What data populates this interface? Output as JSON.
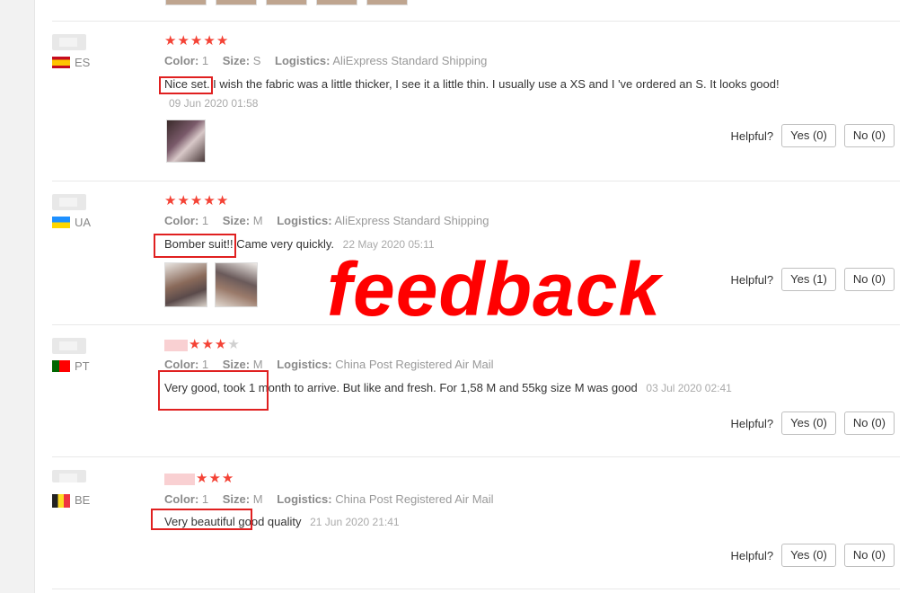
{
  "reviews": [
    {
      "country": "ES",
      "color_label": "Color:",
      "color_value": "1",
      "size_label": "Size:",
      "size_value": "S",
      "logistics_label": "Logistics:",
      "logistics_value": "AliExpress Standard Shipping",
      "text": "Nice set. I wish the fabric was a little thicker, I see it a little thin. I usually use a XS and I 've ordered an S. It looks good!",
      "date": "09 Jun 2020 01:58",
      "helpful_label": "Helpful?",
      "yes_label": "Yes (0)",
      "no_label": "No (0)",
      "stars": 5
    },
    {
      "country": "UA",
      "color_label": "Color:",
      "color_value": "1",
      "size_label": "Size:",
      "size_value": "M",
      "logistics_label": "Logistics:",
      "logistics_value": "AliExpress Standard Shipping",
      "text": "Bomber suit!! Came very quickly.",
      "date": "22 May 2020 05:11",
      "helpful_label": "Helpful?",
      "yes_label": "Yes (1)",
      "no_label": "No (0)",
      "stars": 5
    },
    {
      "country": "PT",
      "color_label": "Color:",
      "color_value": "1",
      "size_label": "Size:",
      "size_value": "M",
      "logistics_label": "Logistics:",
      "logistics_value": "China Post Registered Air Mail",
      "text": "Very good, took 1 month to arrive. But like and fresh. For 1,58 M and 55kg size M was good",
      "date": "03 Jul 2020 02:41",
      "helpful_label": "Helpful?",
      "yes_label": "Yes (0)",
      "no_label": "No (0)",
      "stars": 3
    },
    {
      "country": "BE",
      "color_label": "Color:",
      "color_value": "1",
      "size_label": "Size:",
      "size_value": "M",
      "logistics_label": "Logistics:",
      "logistics_value": "China Post Registered Air Mail",
      "text": "Very beautiful good quality",
      "date": "21 Jun 2020 21:41",
      "helpful_label": "Helpful?",
      "yes_label": "Yes (0)",
      "no_label": "No (0)",
      "stars": 3
    }
  ],
  "overlay_text": "feedback",
  "colors": {
    "star": "#f44336",
    "highlight": "#e02020",
    "overlay": "#ff0000"
  },
  "icons": [
    "star-icon",
    "flag-es-icon",
    "flag-ua-icon",
    "flag-pt-icon",
    "flag-be-icon"
  ]
}
